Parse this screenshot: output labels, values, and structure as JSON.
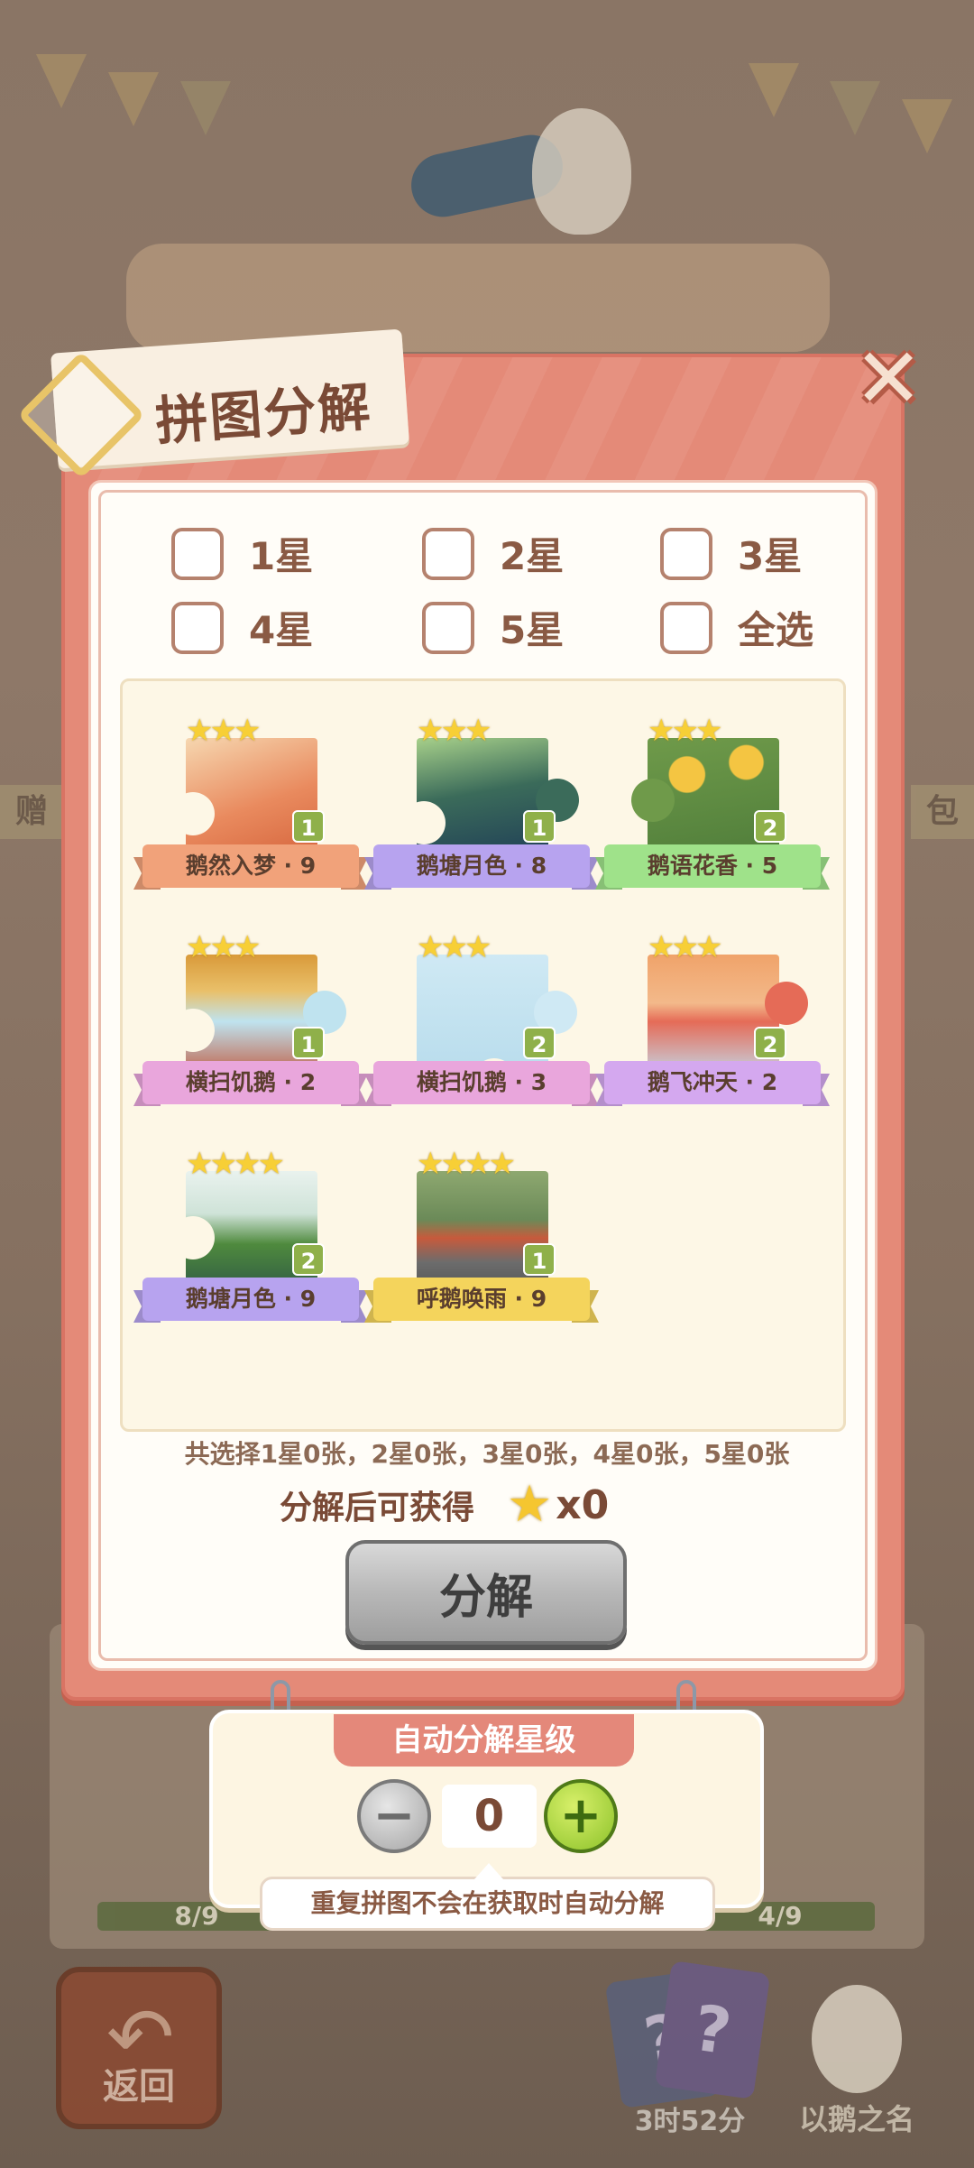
{
  "background": {
    "left_tag": "赠",
    "right_tag": "包",
    "progress_left": "8/9",
    "progress_right": "4/9",
    "back_label": "返回",
    "cards_timer": "3时52分",
    "goose_label": "以鹅之名",
    "card_mark": "?"
  },
  "dialog": {
    "title": "拼图分解",
    "close_glyph": "✕"
  },
  "filters": [
    {
      "label": "1星"
    },
    {
      "label": "2星"
    },
    {
      "label": "3星"
    },
    {
      "label": "4星"
    },
    {
      "label": "5星"
    },
    {
      "label": "全选"
    }
  ],
  "pieces": [
    {
      "name": "鹅然入梦 · 9",
      "stars": "★★★",
      "count": "1",
      "ribbon": "#f1a27a"
    },
    {
      "name": "鹅塘月色 · 8",
      "stars": "★★★",
      "count": "1",
      "ribbon": "#b7a3ef"
    },
    {
      "name": "鹅语花香 · 5",
      "stars": "★★★",
      "count": "2",
      "ribbon": "#9fe28a"
    },
    {
      "name": "横扫饥鹅 · 2",
      "stars": "★★★",
      "count": "1",
      "ribbon": "#e9a6dc"
    },
    {
      "name": "横扫饥鹅 · 3",
      "stars": "★★★",
      "count": "2",
      "ribbon": "#e9a6dc"
    },
    {
      "name": "鹅飞冲天 · 2",
      "stars": "★★★",
      "count": "2",
      "ribbon": "#d4a8ef"
    },
    {
      "name": "鹅塘月色 · 9",
      "stars": "★★★★",
      "count": "2",
      "ribbon": "#b7a3ef"
    },
    {
      "name": "呼鹅唤雨 · 9",
      "stars": "★★★★",
      "count": "1",
      "ribbon": "#f4d45c"
    }
  ],
  "summary": "共选择1星0张，2星0张，3星0张，4星0张，5星0张",
  "gain": {
    "label": "分解后可获得",
    "star_icon": "★",
    "count": "x0"
  },
  "split_button": "分解",
  "auto": {
    "title": "自动分解星级",
    "minus": "−",
    "plus": "+",
    "value": "0",
    "tip": "重复拼图不会在获取时自动分解"
  }
}
